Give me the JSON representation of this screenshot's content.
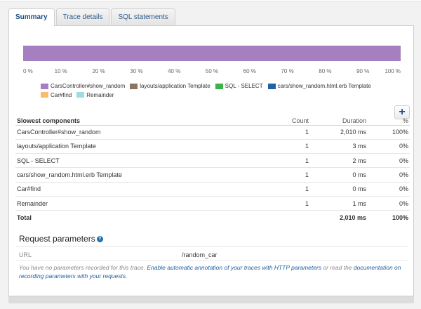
{
  "tabs": [
    {
      "label": "Summary",
      "active": true
    },
    {
      "label": "Trace details",
      "active": false
    },
    {
      "label": "SQL statements",
      "active": false
    }
  ],
  "chart_data": {
    "type": "bar",
    "orientation": "horizontal-stacked",
    "xlim": [
      0,
      100
    ],
    "ticks": [
      "0 %",
      "10 %",
      "20 %",
      "30 %",
      "40 %",
      "50 %",
      "60 %",
      "70 %",
      "80 %",
      "90 %",
      "100 %"
    ],
    "series": [
      {
        "name": "CarsController#show_random",
        "value": 100,
        "color": "#a57fbf"
      },
      {
        "name": "layouts/application Template",
        "value": 0,
        "color": "#8a7462"
      },
      {
        "name": "SQL - SELECT",
        "value": 0,
        "color": "#3cb44b"
      },
      {
        "name": "cars/show_random.html.erb Template",
        "value": 0,
        "color": "#1f62a6"
      },
      {
        "name": "Car#find",
        "value": 0,
        "color": "#f7bd6b"
      },
      {
        "name": "Remainder",
        "value": 0,
        "color": "#9cdde2"
      }
    ]
  },
  "table": {
    "headers": {
      "name": "Slowest components",
      "count": "Count",
      "duration": "Duration",
      "pct": "%"
    },
    "rows": [
      {
        "name": "CarsController#show_random",
        "count": "1",
        "duration": "2,010 ms",
        "pct": "100%"
      },
      {
        "name": "layouts/application Template",
        "count": "1",
        "duration": "3 ms",
        "pct": "0%"
      },
      {
        "name": "SQL - SELECT",
        "count": "1",
        "duration": "2 ms",
        "pct": "0%"
      },
      {
        "name": "cars/show_random.html.erb Template",
        "count": "1",
        "duration": "0 ms",
        "pct": "0%"
      },
      {
        "name": "Car#find",
        "count": "1",
        "duration": "0 ms",
        "pct": "0%"
      },
      {
        "name": "Remainder",
        "count": "1",
        "duration": "1 ms",
        "pct": "0%"
      }
    ],
    "total": {
      "name": "Total",
      "duration": "2,010 ms",
      "pct": "100%"
    }
  },
  "add_button_label": "+",
  "request": {
    "title": "Request parameters",
    "help_glyph": "?",
    "param_label": "URL",
    "param_value": "/random_car",
    "note_before": "You have no parameters recorded for this trace. ",
    "note_link1": "Enable automatic annotation of your traces with HTTP parameters",
    "note_middle": " or read the ",
    "note_link2": "documentation on recording parameters with your requests",
    "note_after": "."
  }
}
